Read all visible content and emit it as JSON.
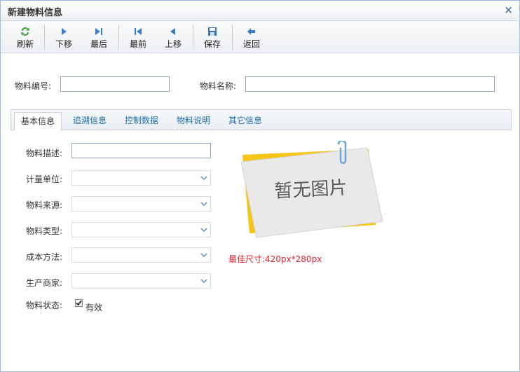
{
  "window": {
    "title": "新建物料信息",
    "close": "×"
  },
  "toolbar": {
    "refresh": "刷新",
    "next": "下移",
    "last": "最后",
    "first": "最前",
    "prev": "上移",
    "save": "保存",
    "back": "返回"
  },
  "header_fields": {
    "code_label": "物料编号:",
    "code_value": "",
    "name_label": "物料名称:",
    "name_value": ""
  },
  "tabs": [
    "基本信息",
    "追溯信息",
    "控制数据",
    "物料说明",
    "其它信息"
  ],
  "form": {
    "description_label": "物料描述:",
    "description_value": "",
    "unit_label": "计量单位:",
    "unit_value": "",
    "source_label": "物料来源:",
    "source_value": "",
    "type_label": "物料类型:",
    "type_value": "",
    "cost_label": "成本方法:",
    "cost_value": "",
    "maker_label": "生产商家:",
    "maker_value": "",
    "status_label": "物料状态:",
    "status_checkbox_label": "有效",
    "status_checked": true
  },
  "image": {
    "placeholder_text": "暂无图片",
    "size_hint": "最佳尺寸:420px*280px"
  },
  "colors": {
    "accent": "#1a6fa8",
    "hint_red": "#e0222a",
    "note_yellow": "#f5c518"
  }
}
